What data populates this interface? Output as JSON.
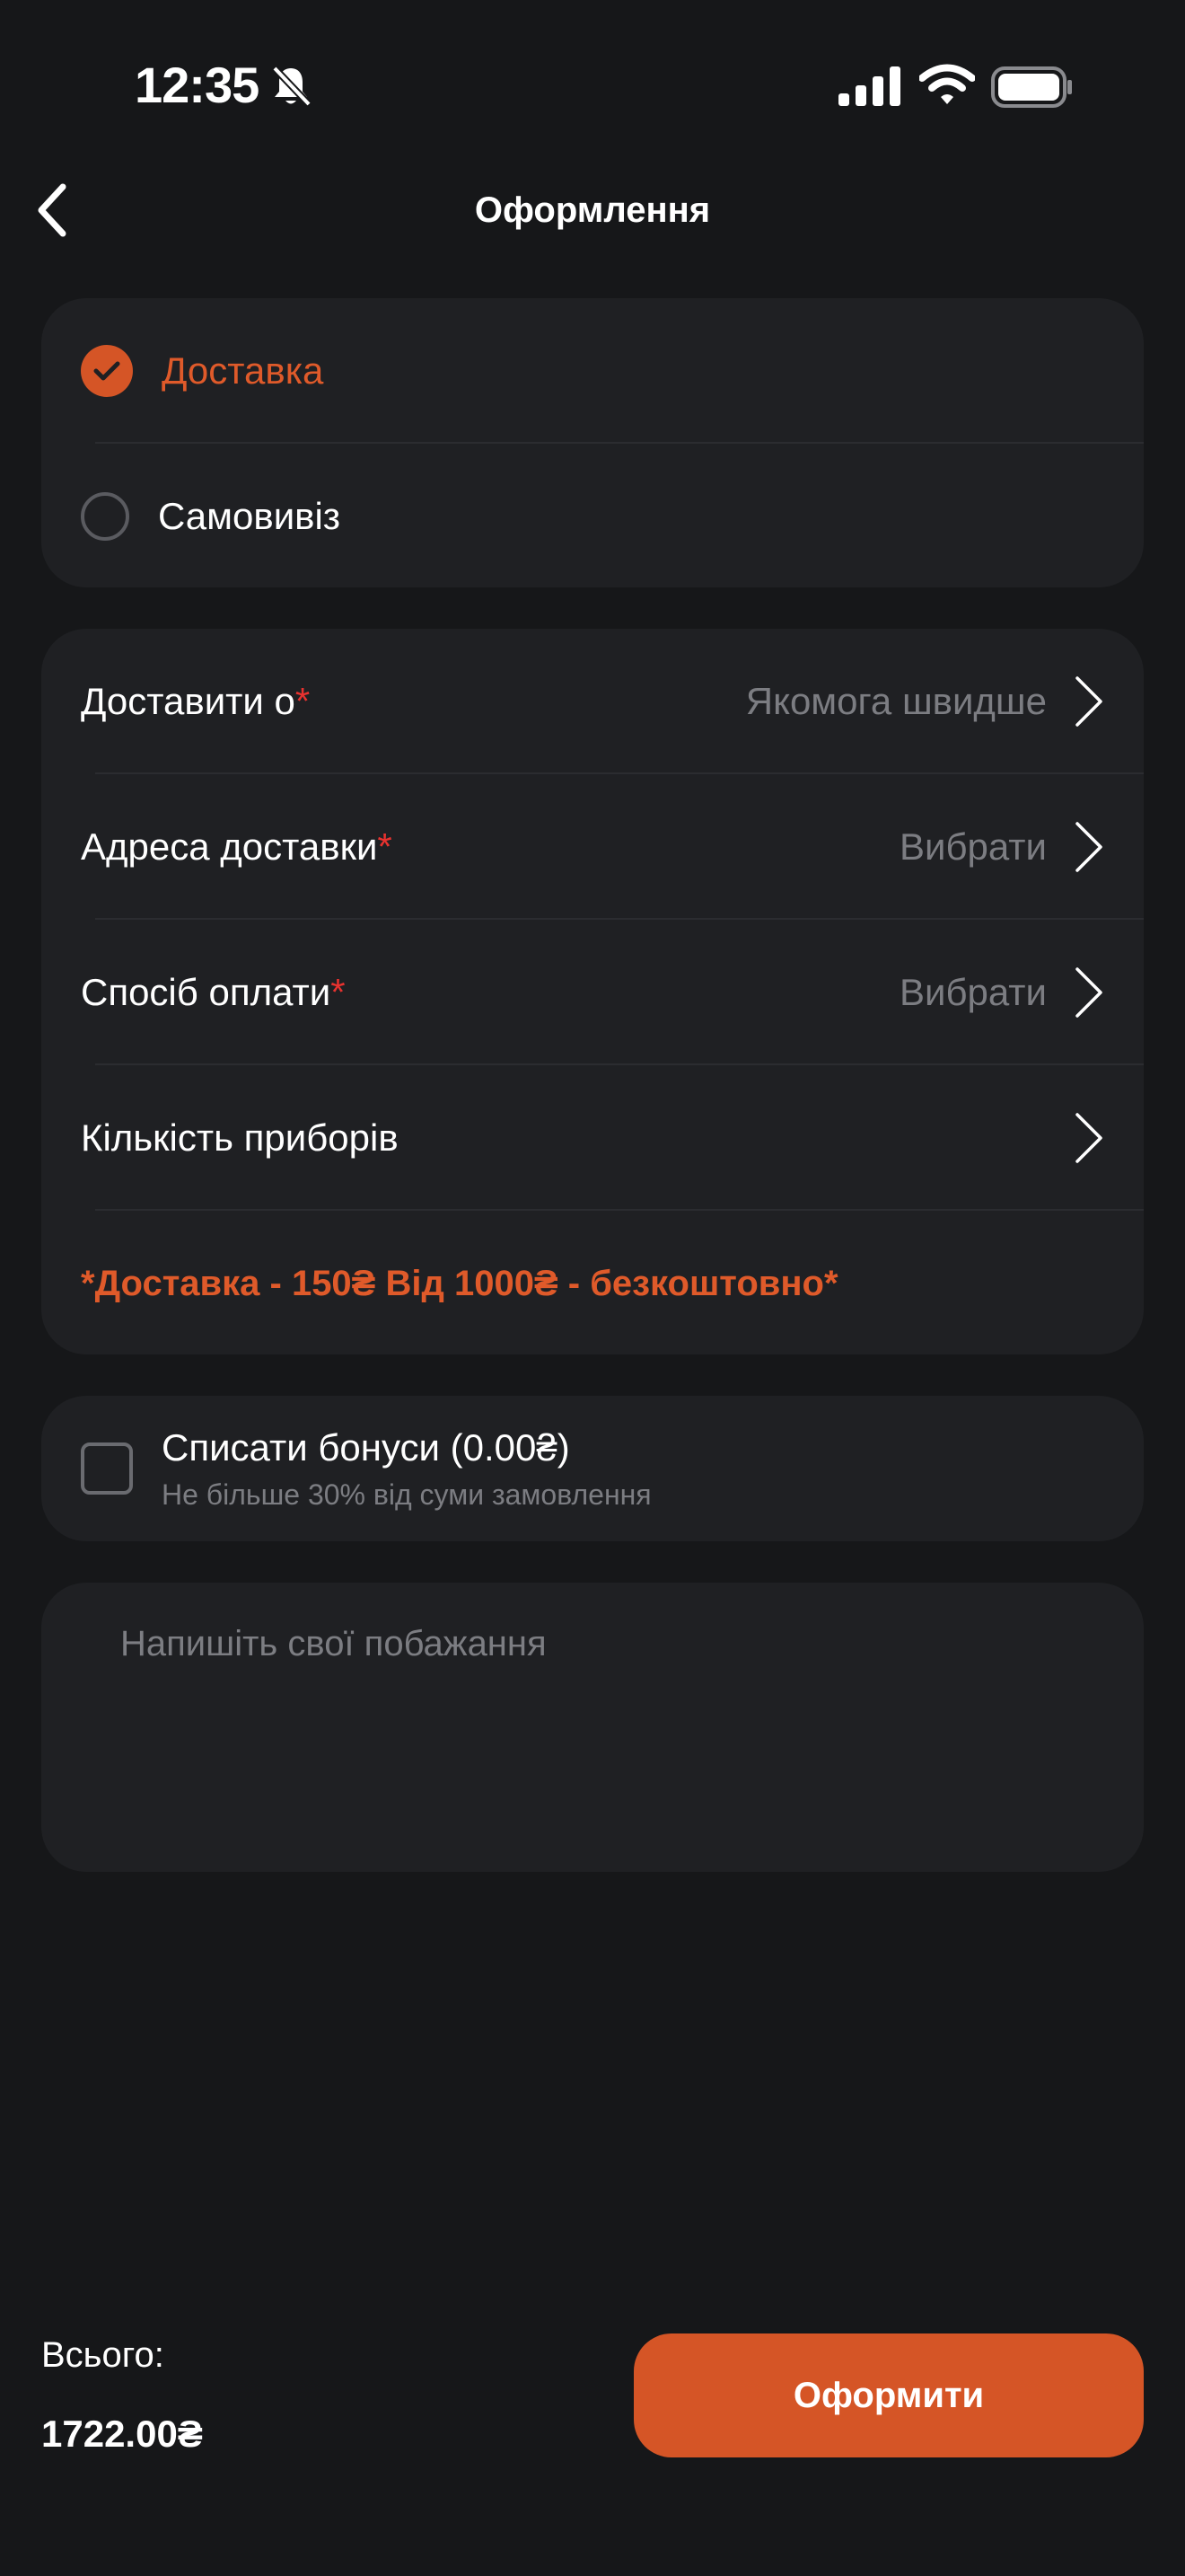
{
  "status_bar": {
    "time": "12:35"
  },
  "header": {
    "title": "Оформлення"
  },
  "delivery_type": {
    "options": [
      {
        "label": "Доставка",
        "selected": true
      },
      {
        "label": "Самовивіз",
        "selected": false
      }
    ]
  },
  "details": {
    "fields": [
      {
        "label": "Доставити о",
        "required_mark": "*",
        "value": "Якомога швидше"
      },
      {
        "label": "Адреса доставки",
        "required_mark": "*",
        "value": "Вибрати"
      },
      {
        "label": "Спосіб оплати",
        "required_mark": "*",
        "value": "Вибрати"
      },
      {
        "label": "Кількість приборів",
        "value": ""
      }
    ],
    "note": "*Доставка - 150₴ Від 1000₴ - безкоштовно*"
  },
  "bonus": {
    "title": "Списати бонуси (0.00₴)",
    "subtitle": "Не більше 30% від суми замовлення",
    "checked": false
  },
  "wishes": {
    "placeholder": "Напишіть свої побажання"
  },
  "footer": {
    "total_label": "Всього:",
    "total_value": "1722.00₴",
    "checkout_label": "Оформити"
  },
  "colors": {
    "background": "#161719",
    "card": "#1f2023",
    "accent": "#d55526",
    "required": "#e8322f",
    "muted_text": "#7c7d82"
  }
}
